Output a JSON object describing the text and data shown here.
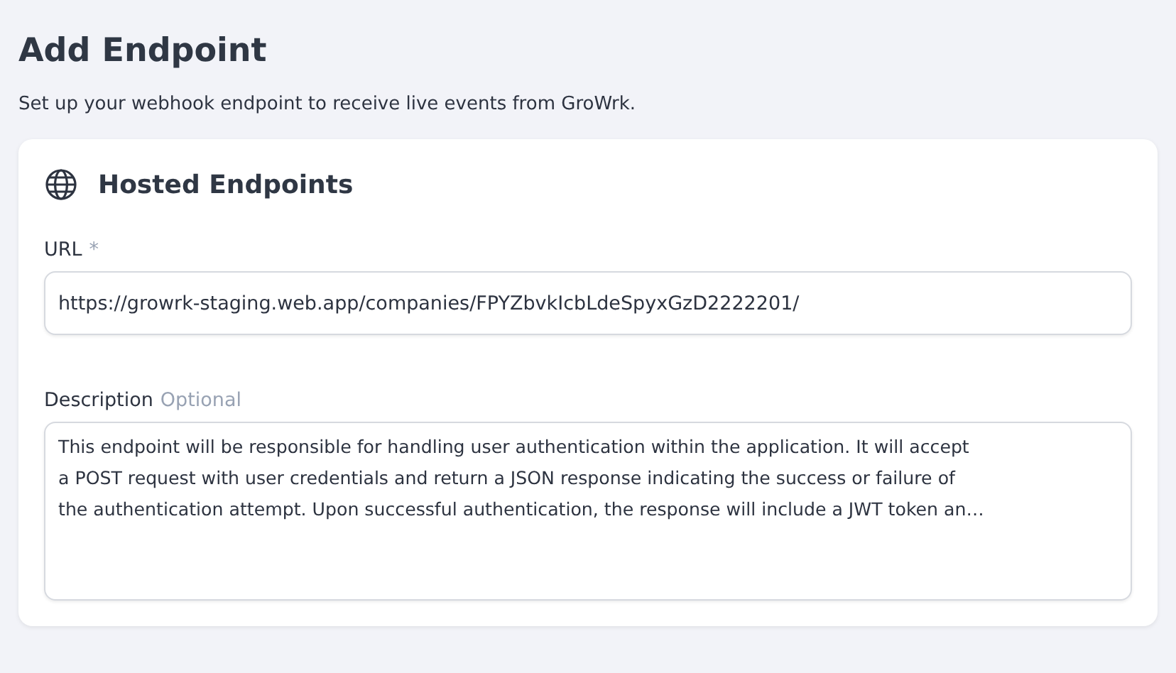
{
  "page": {
    "title": "Add Endpoint",
    "subtitle": "Set up your webhook endpoint to receive live events from GroWrk."
  },
  "card": {
    "title": "Hosted Endpoints",
    "fields": [
      {
        "kind": "input",
        "label": "URL",
        "required_mark": "*",
        "value": "https://growrk-staging.web.app/companies/FPYZbvkIcbLdeSpyxGzD2222201/"
      },
      {
        "kind": "textarea",
        "label": "Description",
        "hint": "Optional",
        "value_lines": [
          "This endpoint will be responsible for handling user authentication within the application. It will accept",
          "a POST request with user credentials and return a JSON response indicating the success or failure of",
          "the authentication attempt. Upon successful authentication, the response will include a JWT token an…"
        ]
      }
    ]
  }
}
